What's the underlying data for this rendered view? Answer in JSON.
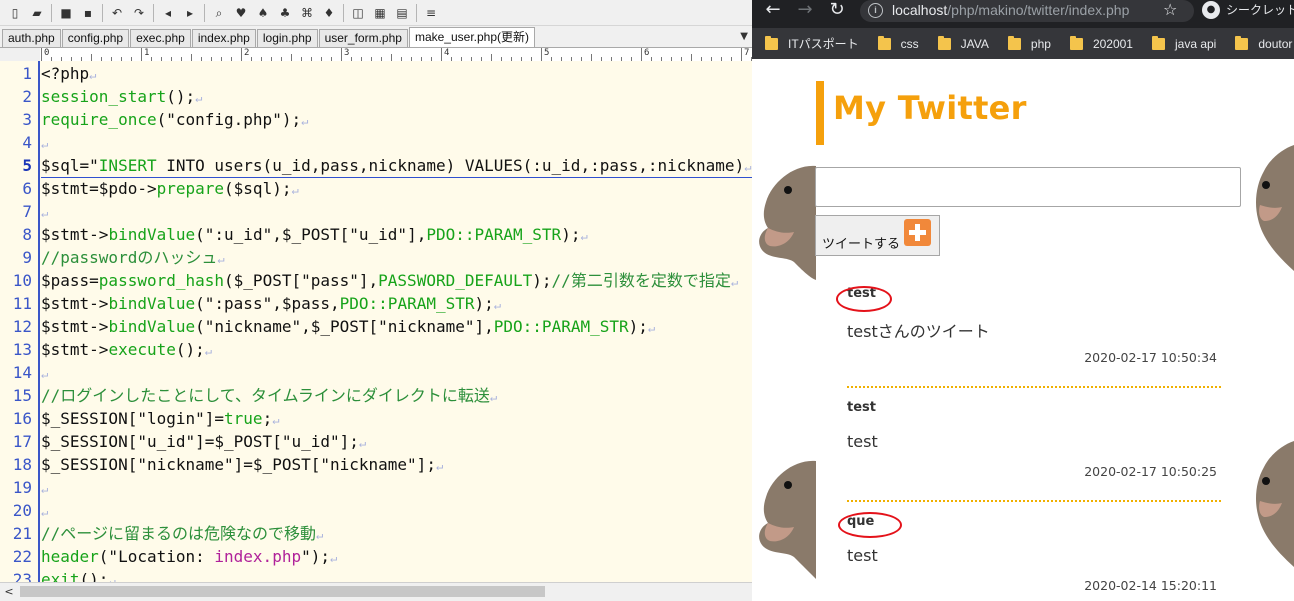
{
  "editor": {
    "toolbar_icons": [
      "new-file-icon",
      "open-folder-icon",
      "save-icon",
      "save-all-icon",
      "undo-icon",
      "redo-icon",
      "back-icon",
      "forward-icon",
      "search-icon",
      "search-next-icon",
      "search-prev-icon",
      "replace-icon",
      "grep-icon",
      "jump-icon",
      "outline-icon",
      "window-icon",
      "split-icon",
      "settings-icon"
    ],
    "tabs": [
      "auth.php",
      "config.php",
      "exec.php",
      "index.php",
      "login.php",
      "user_form.php",
      "make_user.php(更新)"
    ],
    "active_tab": 6,
    "ruler_numbers": [
      "0",
      "1",
      "2",
      "3",
      "4",
      "5",
      "6",
      "7"
    ],
    "current_line": 5,
    "lines": [
      [
        [
          "def",
          "<?php"
        ]
      ],
      [
        [
          "fn",
          "session_start"
        ],
        [
          "def",
          "();"
        ]
      ],
      [
        [
          "fn",
          "require_once"
        ],
        [
          "def",
          "(\"config.php\");"
        ]
      ],
      [],
      [
        [
          "def",
          "$sql=\""
        ],
        [
          "sqlkw",
          "INSERT"
        ],
        [
          "def",
          " INTO users(u_id,pass,nickname) VALUES(:u_id,:pass,:nickname)"
        ]
      ],
      [
        [
          "def",
          "$stmt=$pdo->"
        ],
        [
          "fn",
          "prepare"
        ],
        [
          "def",
          "($sql);"
        ]
      ],
      [],
      [
        [
          "def",
          "$stmt->"
        ],
        [
          "fn",
          "bindValue"
        ],
        [
          "def",
          "(\":u_id\",$_POST[\"u_id\"],"
        ],
        [
          "fn",
          "PDO::PARAM_STR"
        ],
        [
          "def",
          ");"
        ]
      ],
      [
        [
          "cmt",
          "//passwordのハッシュ"
        ]
      ],
      [
        [
          "def",
          "$pass="
        ],
        [
          "fn",
          "password_hash"
        ],
        [
          "def",
          "($_POST[\"pass\"],"
        ],
        [
          "fn",
          "PASSWORD_DEFAULT"
        ],
        [
          "def",
          ");"
        ],
        [
          "cmt",
          "//第二引数を定数で指定"
        ]
      ],
      [
        [
          "def",
          "$stmt->"
        ],
        [
          "fn",
          "bindValue"
        ],
        [
          "def",
          "(\":pass\",$pass,"
        ],
        [
          "fn",
          "PDO::PARAM_STR"
        ],
        [
          "def",
          ");"
        ]
      ],
      [
        [
          "def",
          "$stmt->"
        ],
        [
          "fn",
          "bindValue"
        ],
        [
          "def",
          "(\"nickname\",$_POST[\"nickname\"],"
        ],
        [
          "fn",
          "PDO::PARAM_STR"
        ],
        [
          "def",
          ");"
        ]
      ],
      [
        [
          "def",
          "$stmt->"
        ],
        [
          "fn",
          "execute"
        ],
        [
          "def",
          "();"
        ]
      ],
      [],
      [
        [
          "cmt",
          "//ログインしたことにして、タイムラインにダイレクトに転送"
        ]
      ],
      [
        [
          "def",
          "$_SESSION[\"login\"]="
        ],
        [
          "fn",
          "true"
        ],
        [
          "def",
          ";"
        ]
      ],
      [
        [
          "def",
          "$_SESSION[\"u_id\"]=$_POST[\"u_id\"];"
        ]
      ],
      [
        [
          "def",
          "$_SESSION[\"nickname\"]=$_POST[\"nickname\"];"
        ]
      ],
      [],
      [],
      [
        [
          "cmt",
          "//ページに留まるのは危険なので移動"
        ]
      ],
      [
        [
          "fn",
          "header"
        ],
        [
          "def",
          "(\"Location: "
        ],
        [
          "key",
          "index.php"
        ],
        [
          "def",
          "\");"
        ]
      ],
      [
        [
          "fn",
          "exit"
        ],
        [
          "def",
          "();"
        ]
      ]
    ]
  },
  "browser": {
    "url_host": "localhost",
    "url_path": "/php/makino/twitter/index.php",
    "incognito_label": "シークレット",
    "bookmarks": [
      "ITパスポート",
      "css",
      "JAVA",
      "php",
      "202001",
      "java api",
      "doutor"
    ],
    "page": {
      "title": "My Twitter",
      "tweet_button_label": "ツイートする",
      "posts": [
        {
          "user": "test",
          "text": "testさんのツイート",
          "time": "2020-02-17 10:50:34"
        },
        {
          "user": "test",
          "text": "test",
          "time": "2020-02-17 10:50:25"
        },
        {
          "user": "que",
          "text": "test",
          "time": "2020-02-14 15:20:11"
        }
      ]
    }
  },
  "colors": {
    "accent": "#f5a00c",
    "line_number": "#3a56c8",
    "function": "#17a31a",
    "comment": "#2c8f3a",
    "keyword": "#b0219a",
    "editor_bg": "#fffbea",
    "annotation_circle": "#e4121a"
  }
}
